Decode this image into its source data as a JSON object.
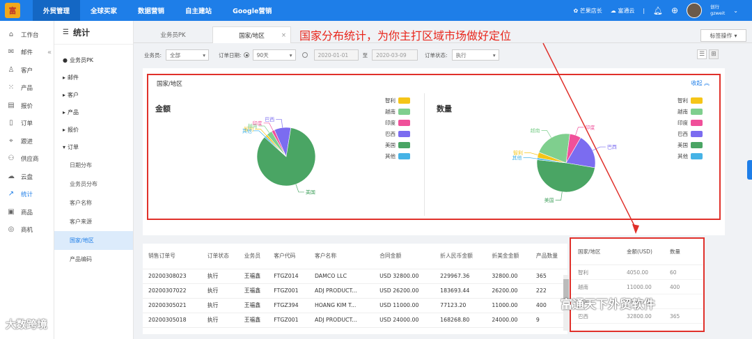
{
  "topnav": {
    "logo": "富",
    "items": [
      "外贸管理",
      "全球买家",
      "数据营销",
      "自主建站",
      "Google营销"
    ],
    "right": {
      "shop": "芒果店长",
      "cloud": "富通云",
      "user_line1": "创行",
      "user_line2": "gzweit"
    }
  },
  "sidebar": {
    "items": [
      "工作台",
      "邮件",
      "客户",
      "产品",
      "报价",
      "订单",
      "跟进",
      "供应商",
      "云盘",
      "统计",
      "商品",
      "商机"
    ]
  },
  "stats": {
    "title": "统计",
    "tree": [
      {
        "label": "业务员PK",
        "level": 0
      },
      {
        "label": "邮件",
        "level": 0
      },
      {
        "label": "客户",
        "level": 0
      },
      {
        "label": "产品",
        "level": 0
      },
      {
        "label": "报价",
        "level": 0
      },
      {
        "label": "订单",
        "level": 0
      },
      {
        "label": "日期分布",
        "level": 1
      },
      {
        "label": "业务员分布",
        "level": 1
      },
      {
        "label": "客户名称",
        "level": 1
      },
      {
        "label": "客户来源",
        "level": 1
      },
      {
        "label": "国家/地区",
        "level": 1
      },
      {
        "label": "产品编码",
        "level": 1
      }
    ]
  },
  "tabs": {
    "tab1": "业务员PK",
    "tab2": "国家/地区",
    "close": "×"
  },
  "headline": "国家分布统计，为你主打区域市场做好定位",
  "tag_button": "标签操作",
  "filters": {
    "salesman_label": "业务员:",
    "salesman_value": "全部",
    "date_label": "订单日期:",
    "period_value": "90天",
    "date_from": "2020-01-01",
    "date_to_label": "至",
    "date_to": "2020-03-09",
    "status_label": "订单状态:",
    "status_value": "执行"
  },
  "chart_panel": {
    "title": "国家/地区",
    "collapse": "收起"
  },
  "chart_data": [
    {
      "type": "pie",
      "title": "金额",
      "labels": [
        "智利",
        "越南",
        "印度",
        "巴西",
        "美国",
        "其他"
      ],
      "values": [
        4050,
        11000,
        6000,
        32800,
        300000,
        3000
      ],
      "colors": [
        "#f5c518",
        "#7fcf8e",
        "#f0509a",
        "#7b6cf0",
        "#4aa564",
        "#46b3e6"
      ],
      "legend_position": "top-right"
    },
    {
      "type": "pie",
      "title": "数量",
      "labels": [
        "智利",
        "越南",
        "印度",
        "巴西",
        "美国",
        "其他"
      ],
      "values": [
        60,
        400,
        120,
        365,
        930,
        20
      ],
      "colors": [
        "#f5c518",
        "#7fcf8e",
        "#f0509a",
        "#7b6cf0",
        "#4aa564",
        "#46b3e6"
      ],
      "legend_position": "top-right"
    }
  ],
  "orders": {
    "headers": [
      "销售订单号",
      "订单状态",
      "业务员",
      "客户代码",
      "客户名称",
      "合同金额",
      "折人民币金额",
      "折美金金额",
      "产品数量"
    ],
    "rows": [
      [
        "20200308023",
        "执行",
        "王福鑫",
        "FTGZ014",
        "DAMCO LLC",
        "USD 32800.00",
        "229967.36",
        "32800.00",
        "365"
      ],
      [
        "20200307022",
        "执行",
        "王福鑫",
        "FTGZ001",
        "ADJ PRODUCT...",
        "USD 26200.00",
        "183693.44",
        "26200.00",
        "222"
      ],
      [
        "20200305021",
        "执行",
        "王福鑫",
        "FTGZ394",
        "HOANG KIM T...",
        "USD 11000.00",
        "77123.20",
        "11000.00",
        "400"
      ],
      [
        "20200305018",
        "执行",
        "王福鑫",
        "FTGZ001",
        "ADJ PRODUCT...",
        "USD 24000.00",
        "168268.80",
        "24000.00",
        "9"
      ]
    ]
  },
  "summary": {
    "headers": [
      "国家/地区",
      "金额(USD)",
      "数量"
    ],
    "rows": [
      [
        "智利",
        "4050.00",
        "60"
      ],
      [
        "越南",
        "11000.00",
        "400"
      ],
      [
        "印度",
        "17360.00",
        ""
      ],
      [
        "巴西",
        "32800.00",
        "365"
      ]
    ]
  },
  "watermarks": {
    "left": "大数跨境",
    "right": "富通天下外贸软件"
  }
}
